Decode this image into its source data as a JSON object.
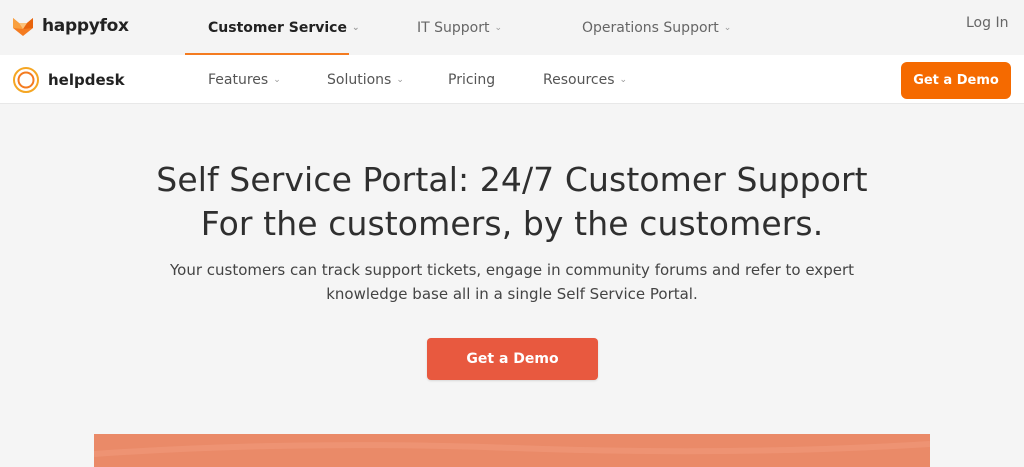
{
  "topbar": {
    "brand": "happyfox",
    "nav": [
      {
        "label": "Customer Service",
        "active": true
      },
      {
        "label": "IT Support",
        "active": false
      },
      {
        "label": "Operations Support",
        "active": false
      }
    ],
    "login": "Log In"
  },
  "subbar": {
    "brand": "helpdesk",
    "nav": [
      {
        "label": "Features",
        "dropdown": true
      },
      {
        "label": "Solutions",
        "dropdown": true
      },
      {
        "label": "Pricing",
        "dropdown": false
      },
      {
        "label": "Resources",
        "dropdown": true
      }
    ],
    "cta": "Get a Demo"
  },
  "hero": {
    "title_line1": "Self Service Portal: 24/7 Customer Support",
    "title_line2": "For the customers, by the customers.",
    "subtitle": "Your customers can track support tickets, engage in community forums and refer to expert knowledge base all in a single Self Service Portal.",
    "cta": "Get a Demo"
  },
  "icons": {
    "dropdown": "chevron-down-icon",
    "brand": "fox-logo-icon",
    "helpdesk": "ring-logo-icon"
  },
  "colors": {
    "accent_orange": "#f56a00",
    "hero_button": "#e8593f",
    "active_underline": "#f47b20",
    "hero_strip": "#ea8a68"
  }
}
